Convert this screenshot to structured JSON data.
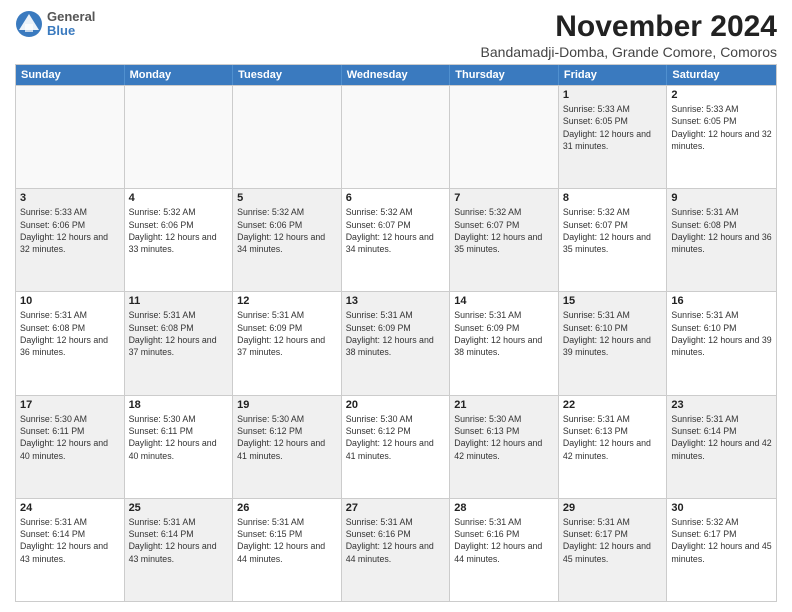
{
  "brand": {
    "line1": "General",
    "line2": "Blue"
  },
  "title": "November 2024",
  "subtitle": "Bandamadji-Domba, Grande Comore, Comoros",
  "weekdays": [
    "Sunday",
    "Monday",
    "Tuesday",
    "Wednesday",
    "Thursday",
    "Friday",
    "Saturday"
  ],
  "weeks": [
    [
      {
        "day": "",
        "text": "",
        "empty": true
      },
      {
        "day": "",
        "text": "",
        "empty": true
      },
      {
        "day": "",
        "text": "",
        "empty": true
      },
      {
        "day": "",
        "text": "",
        "empty": true
      },
      {
        "day": "",
        "text": "",
        "empty": true
      },
      {
        "day": "1",
        "text": "Sunrise: 5:33 AM\nSunset: 6:05 PM\nDaylight: 12 hours and 31 minutes.",
        "shaded": true
      },
      {
        "day": "2",
        "text": "Sunrise: 5:33 AM\nSunset: 6:05 PM\nDaylight: 12 hours and 32 minutes.",
        "shaded": false
      }
    ],
    [
      {
        "day": "3",
        "text": "Sunrise: 5:33 AM\nSunset: 6:06 PM\nDaylight: 12 hours and 32 minutes.",
        "shaded": true
      },
      {
        "day": "4",
        "text": "Sunrise: 5:32 AM\nSunset: 6:06 PM\nDaylight: 12 hours and 33 minutes.",
        "shaded": false
      },
      {
        "day": "5",
        "text": "Sunrise: 5:32 AM\nSunset: 6:06 PM\nDaylight: 12 hours and 34 minutes.",
        "shaded": true
      },
      {
        "day": "6",
        "text": "Sunrise: 5:32 AM\nSunset: 6:07 PM\nDaylight: 12 hours and 34 minutes.",
        "shaded": false
      },
      {
        "day": "7",
        "text": "Sunrise: 5:32 AM\nSunset: 6:07 PM\nDaylight: 12 hours and 35 minutes.",
        "shaded": true
      },
      {
        "day": "8",
        "text": "Sunrise: 5:32 AM\nSunset: 6:07 PM\nDaylight: 12 hours and 35 minutes.",
        "shaded": false
      },
      {
        "day": "9",
        "text": "Sunrise: 5:31 AM\nSunset: 6:08 PM\nDaylight: 12 hours and 36 minutes.",
        "shaded": true
      }
    ],
    [
      {
        "day": "10",
        "text": "Sunrise: 5:31 AM\nSunset: 6:08 PM\nDaylight: 12 hours and 36 minutes.",
        "shaded": false
      },
      {
        "day": "11",
        "text": "Sunrise: 5:31 AM\nSunset: 6:08 PM\nDaylight: 12 hours and 37 minutes.",
        "shaded": true
      },
      {
        "day": "12",
        "text": "Sunrise: 5:31 AM\nSunset: 6:09 PM\nDaylight: 12 hours and 37 minutes.",
        "shaded": false
      },
      {
        "day": "13",
        "text": "Sunrise: 5:31 AM\nSunset: 6:09 PM\nDaylight: 12 hours and 38 minutes.",
        "shaded": true
      },
      {
        "day": "14",
        "text": "Sunrise: 5:31 AM\nSunset: 6:09 PM\nDaylight: 12 hours and 38 minutes.",
        "shaded": false
      },
      {
        "day": "15",
        "text": "Sunrise: 5:31 AM\nSunset: 6:10 PM\nDaylight: 12 hours and 39 minutes.",
        "shaded": true
      },
      {
        "day": "16",
        "text": "Sunrise: 5:31 AM\nSunset: 6:10 PM\nDaylight: 12 hours and 39 minutes.",
        "shaded": false
      }
    ],
    [
      {
        "day": "17",
        "text": "Sunrise: 5:30 AM\nSunset: 6:11 PM\nDaylight: 12 hours and 40 minutes.",
        "shaded": true
      },
      {
        "day": "18",
        "text": "Sunrise: 5:30 AM\nSunset: 6:11 PM\nDaylight: 12 hours and 40 minutes.",
        "shaded": false
      },
      {
        "day": "19",
        "text": "Sunrise: 5:30 AM\nSunset: 6:12 PM\nDaylight: 12 hours and 41 minutes.",
        "shaded": true
      },
      {
        "day": "20",
        "text": "Sunrise: 5:30 AM\nSunset: 6:12 PM\nDaylight: 12 hours and 41 minutes.",
        "shaded": false
      },
      {
        "day": "21",
        "text": "Sunrise: 5:30 AM\nSunset: 6:13 PM\nDaylight: 12 hours and 42 minutes.",
        "shaded": true
      },
      {
        "day": "22",
        "text": "Sunrise: 5:31 AM\nSunset: 6:13 PM\nDaylight: 12 hours and 42 minutes.",
        "shaded": false
      },
      {
        "day": "23",
        "text": "Sunrise: 5:31 AM\nSunset: 6:14 PM\nDaylight: 12 hours and 42 minutes.",
        "shaded": true
      }
    ],
    [
      {
        "day": "24",
        "text": "Sunrise: 5:31 AM\nSunset: 6:14 PM\nDaylight: 12 hours and 43 minutes.",
        "shaded": false
      },
      {
        "day": "25",
        "text": "Sunrise: 5:31 AM\nSunset: 6:14 PM\nDaylight: 12 hours and 43 minutes.",
        "shaded": true
      },
      {
        "day": "26",
        "text": "Sunrise: 5:31 AM\nSunset: 6:15 PM\nDaylight: 12 hours and 44 minutes.",
        "shaded": false
      },
      {
        "day": "27",
        "text": "Sunrise: 5:31 AM\nSunset: 6:16 PM\nDaylight: 12 hours and 44 minutes.",
        "shaded": true
      },
      {
        "day": "28",
        "text": "Sunrise: 5:31 AM\nSunset: 6:16 PM\nDaylight: 12 hours and 44 minutes.",
        "shaded": false
      },
      {
        "day": "29",
        "text": "Sunrise: 5:31 AM\nSunset: 6:17 PM\nDaylight: 12 hours and 45 minutes.",
        "shaded": true
      },
      {
        "day": "30",
        "text": "Sunrise: 5:32 AM\nSunset: 6:17 PM\nDaylight: 12 hours and 45 minutes.",
        "shaded": false
      }
    ]
  ]
}
